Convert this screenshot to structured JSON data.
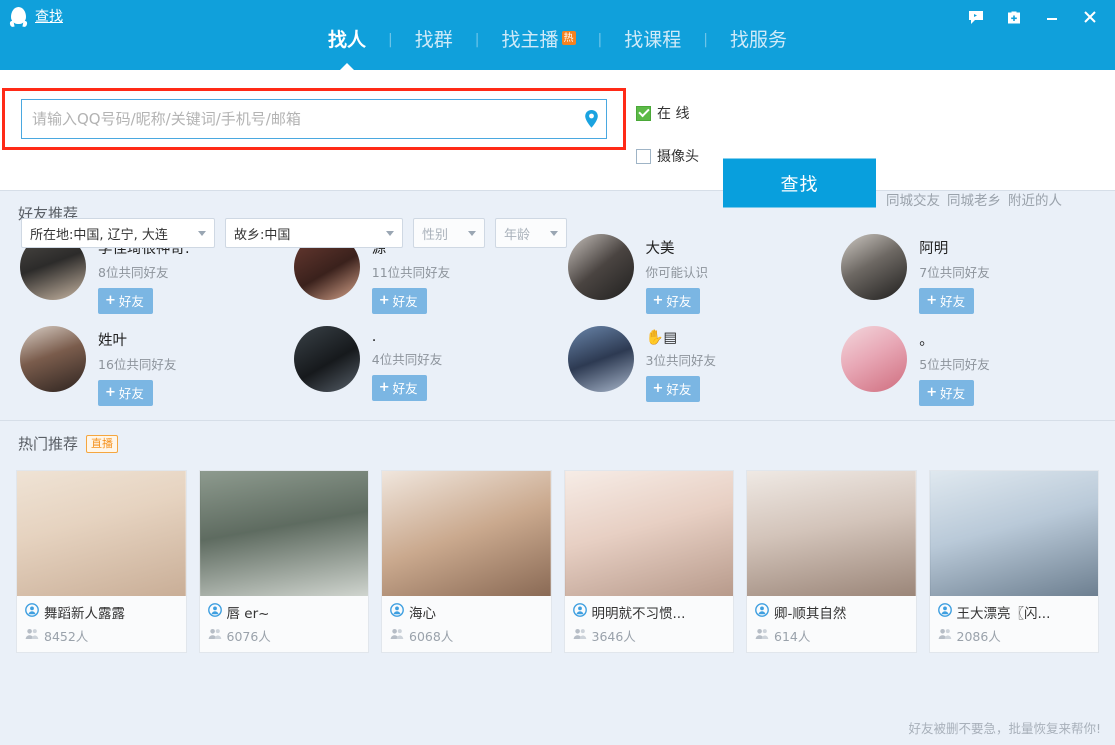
{
  "window": {
    "title": "查找",
    "logo_icon": "qq-penguin-icon",
    "controls": [
      {
        "name": "feedback-icon",
        "label": "反馈"
      },
      {
        "name": "medkit-icon",
        "label": "体检"
      },
      {
        "name": "minimize-icon",
        "label": "最小化"
      },
      {
        "name": "close-icon",
        "label": "关闭"
      }
    ],
    "accent_color": "#10a0db"
  },
  "tabs": [
    {
      "label": "找人",
      "active": true,
      "badge": ""
    },
    {
      "label": "找群",
      "active": false,
      "badge": ""
    },
    {
      "label": "找主播",
      "active": false,
      "badge": "热"
    },
    {
      "label": "找课程",
      "active": false,
      "badge": ""
    },
    {
      "label": "找服务",
      "active": false,
      "badge": ""
    }
  ],
  "tab_separator": "|",
  "search": {
    "placeholder": "请输入QQ号码/昵称/关键词/手机号/邮箱",
    "value": "",
    "pin_icon": "location-pin-icon",
    "highlight_color": "#ff2a17",
    "button_label": "查找",
    "checkboxes": [
      {
        "label": "在  线",
        "checked": true
      },
      {
        "label": "摄像头",
        "checked": false
      }
    ],
    "quick_links": [
      "同城交友",
      "同城老乡",
      "附近的人"
    ],
    "filters": [
      {
        "name": "location",
        "value": "所在地:中国, 辽宁, 大连",
        "placeholder": false
      },
      {
        "name": "hometown",
        "value": "故乡:中国",
        "placeholder": false
      },
      {
        "name": "gender",
        "value": "性别",
        "placeholder": true
      },
      {
        "name": "age",
        "value": "年龄",
        "placeholder": true
      }
    ]
  },
  "friends_section": {
    "title": "好友推荐",
    "add_label": "好友",
    "add_plus": "+",
    "items": [
      {
        "name": "李佳琦很神奇.",
        "sub": "8位共同好友",
        "avatar": "linear-gradient(160deg,#4d4a46 0%,#2c2b2a 45%,#c9b7a4 100%)"
      },
      {
        "name": "源",
        "sub": "11位共同好友",
        "avatar": "linear-gradient(150deg,#6b3b32 0%,#3a211c 55%,#d8a58c 100%)"
      },
      {
        "name": "大美",
        "sub": "你可能认识",
        "avatar": "linear-gradient(140deg,#c8c2bd 0%,#4a4441 50%,#20201f 100%)"
      },
      {
        "name": "阿明",
        "sub": "7位共同好友",
        "avatar": "linear-gradient(150deg,#cfcac4 0%,#6d6863 45%,#1f1e1d 100%)"
      },
      {
        "name": "姓叶",
        "sub": "16位共同好友",
        "avatar": "linear-gradient(160deg,#d9cfc6 0%,#7a5c4c 45%,#2e2420 100%)"
      },
      {
        "name": ".",
        "sub": "4位共同好友",
        "avatar": "linear-gradient(150deg,#3a4248 0%,#16191c 55%,#57606a 100%)"
      },
      {
        "name": "✋▤",
        "sub": "3位共同好友",
        "avatar": "linear-gradient(160deg,#6a86ab 0%,#2d3a52 50%,#a8b6cb 100%)"
      },
      {
        "name": "。",
        "sub": "5位共同好友",
        "avatar": "linear-gradient(150deg,#f3d8dd 0%,#e8a8b6 45%,#cf6d7e 100%)"
      }
    ]
  },
  "live_section": {
    "title": "热门推荐",
    "badge": "直播",
    "viewer_suffix": "人",
    "anchor_icon": "anchor-avatar-icon",
    "viewers_icon": "viewers-icon",
    "items": [
      {
        "name": "舞蹈新人露露",
        "viewers": "8452人",
        "thumb": "linear-gradient(165deg,#efe3d5 0%,#e6d3c0 40%,#c9ae97 100%)"
      },
      {
        "name": "唇 er~",
        "viewers": "6076人",
        "thumb": "linear-gradient(170deg,#8d9a8e 0%,#5e6b60 45%,#cfd4ce 100%)"
      },
      {
        "name": "海心",
        "viewers": "6068人",
        "thumb": "linear-gradient(160deg,#f0e6dd 0%,#caa98e 50%,#8a6a55 100%)"
      },
      {
        "name": "明明就不习惯...",
        "viewers": "3646人",
        "thumb": "linear-gradient(165deg,#f6ece6 0%,#e7cfc3 45%,#b79a8b 100%)"
      },
      {
        "name": "卿-顺其自然",
        "viewers": "614人",
        "thumb": "linear-gradient(170deg,#efe9e4 0%,#d3c4ba 45%,#9b8679 100%)"
      },
      {
        "name": "王大漂亮〖闪...",
        "viewers": "2086人",
        "thumb": "linear-gradient(165deg,#dfe8ef 0%,#b9c9d8 45%,#6d7f90 100%)"
      }
    ]
  },
  "footer": {
    "text": "好友被删不要急，批量恢复来帮你!"
  }
}
